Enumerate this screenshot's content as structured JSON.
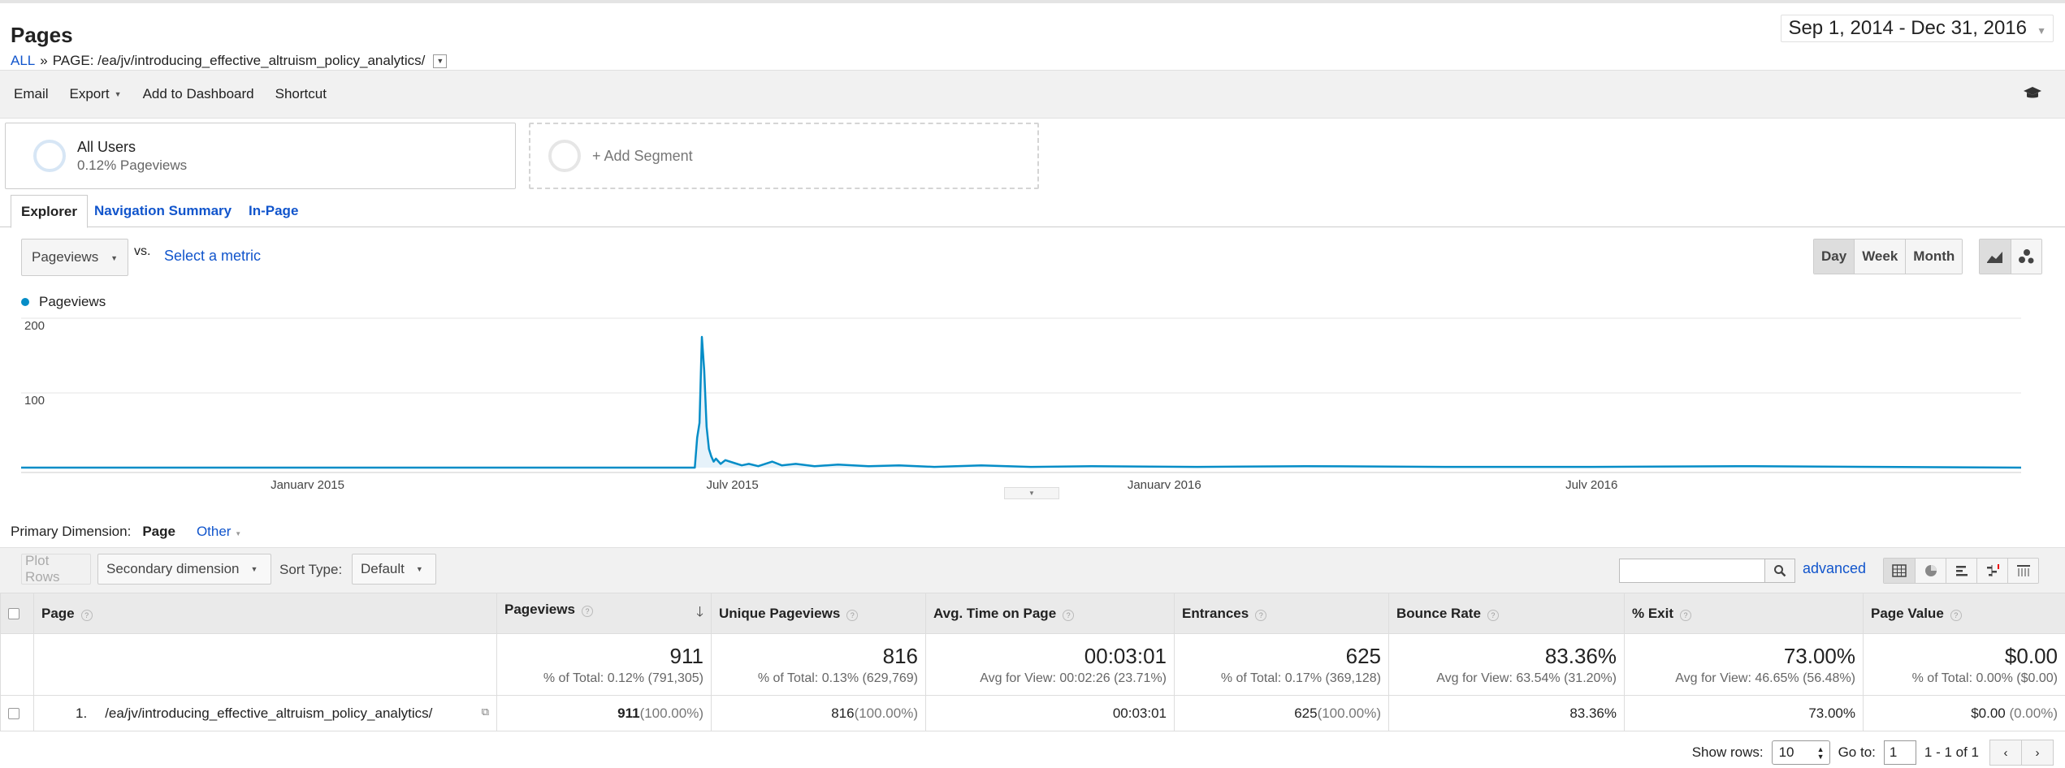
{
  "header": {
    "title": "Pages",
    "breadcrumb_all": "ALL",
    "breadcrumb_sep": "»",
    "breadcrumb_current": "PAGE: /ea/jv/introducing_effective_altruism_policy_analytics/",
    "date_range": "Sep 1, 2014 - Dec 31, 2016"
  },
  "toolbar": {
    "email": "Email",
    "export": "Export",
    "add_to_dashboard": "Add to Dashboard",
    "shortcut": "Shortcut",
    "icon": "graduation-cap-icon"
  },
  "segments": {
    "all_users_name": "All Users",
    "all_users_sub": "0.12% Pageviews",
    "add_segment": "+ Add Segment"
  },
  "tabs": [
    "Explorer",
    "Navigation Summary",
    "In-Page"
  ],
  "metric": {
    "selected": "Pageviews",
    "vs": "vs.",
    "select_metric": "Select a metric"
  },
  "granularity": [
    "Day",
    "Week",
    "Month"
  ],
  "chart_data": {
    "type": "line",
    "series": [
      {
        "name": "Pageviews",
        "color": "#058dc7"
      }
    ],
    "y_ticks": [
      "200",
      "100"
    ],
    "ylim": [
      0,
      200
    ],
    "x_tick_labels": [
      "January 2015",
      "July 2015",
      "January 2016",
      "July 2016"
    ],
    "x_tick_dates": [
      "2015-01-01",
      "2015-07-01",
      "2016-01-01",
      "2016-07-01"
    ],
    "xlim": [
      "2014-09-01",
      "2016-12-31"
    ],
    "points": [
      [
        "2015-06-15",
        0
      ],
      [
        "2015-06-16",
        40
      ],
      [
        "2015-06-17",
        60
      ],
      [
        "2015-06-18",
        175
      ],
      [
        "2015-06-19",
        130
      ],
      [
        "2015-06-20",
        55
      ],
      [
        "2015-06-21",
        25
      ],
      [
        "2015-06-22",
        15
      ],
      [
        "2015-06-23",
        8
      ],
      [
        "2015-06-24",
        12
      ],
      [
        "2015-06-26",
        5
      ],
      [
        "2015-06-28",
        10
      ],
      [
        "2015-07-02",
        6
      ],
      [
        "2015-07-05",
        3
      ],
      [
        "2015-07-08",
        5
      ],
      [
        "2015-07-12",
        2
      ],
      [
        "2015-07-18",
        8
      ],
      [
        "2015-07-22",
        3
      ],
      [
        "2015-07-28",
        5
      ],
      [
        "2015-08-05",
        2
      ],
      [
        "2015-08-15",
        4
      ],
      [
        "2015-08-28",
        2
      ],
      [
        "2015-09-10",
        3
      ],
      [
        "2015-09-25",
        1
      ],
      [
        "2015-10-15",
        3
      ],
      [
        "2015-11-05",
        1
      ],
      [
        "2015-12-01",
        2
      ],
      [
        "2016-01-15",
        1
      ],
      [
        "2016-03-01",
        2
      ],
      [
        "2016-05-01",
        1
      ],
      [
        "2016-07-01",
        1
      ],
      [
        "2016-09-01",
        2
      ],
      [
        "2016-11-01",
        1
      ],
      [
        "2016-12-31",
        0
      ]
    ],
    "grid": true,
    "legend": "top-left"
  },
  "primary_dimension": {
    "label": "Primary Dimension:",
    "current": "Page",
    "other": "Other"
  },
  "table_toolbar": {
    "plot_rows": "Plot Rows",
    "secondary_dimension": "Secondary dimension",
    "sort_type_label": "Sort Type:",
    "sort_type": "Default",
    "advanced": "advanced"
  },
  "table": {
    "headers": [
      "Page",
      "Pageviews",
      "Unique Pageviews",
      "Avg. Time on Page",
      "Entrances",
      "Bounce Rate",
      "% Exit",
      "Page Value"
    ],
    "totals": [
      {
        "big": "911",
        "sub": "% of Total: 0.12% (791,305)"
      },
      {
        "big": "816",
        "sub": "% of Total: 0.13% (629,769)"
      },
      {
        "big": "00:03:01",
        "sub": "Avg for View: 00:02:26 (23.71%)"
      },
      {
        "big": "625",
        "sub": "% of Total: 0.17% (369,128)"
      },
      {
        "big": "83.36%",
        "sub": "Avg for View: 63.54% (31.20%)"
      },
      {
        "big": "73.00%",
        "sub": "Avg for View: 46.65% (56.48%)"
      },
      {
        "big": "$0.00",
        "sub": "% of Total: 0.00% ($0.00)"
      }
    ],
    "rows": [
      {
        "index": "1.",
        "page": "/ea/jv/introducing_effective_altruism_policy_analytics/",
        "pageviews": "911",
        "pageviews_pct": "(100.00%)",
        "unique": "816",
        "unique_pct": "(100.00%)",
        "avg_time": "00:03:01",
        "entrances": "625",
        "entrances_pct": "(100.00%)",
        "bounce": "83.36%",
        "exit": "73.00%",
        "value": "$0.00",
        "value_pct": "(0.00%)"
      }
    ]
  },
  "footer": {
    "show_rows_label": "Show rows:",
    "show_rows": "10",
    "goto_label": "Go to:",
    "goto": "1",
    "range": "1 - 1 of 1"
  }
}
